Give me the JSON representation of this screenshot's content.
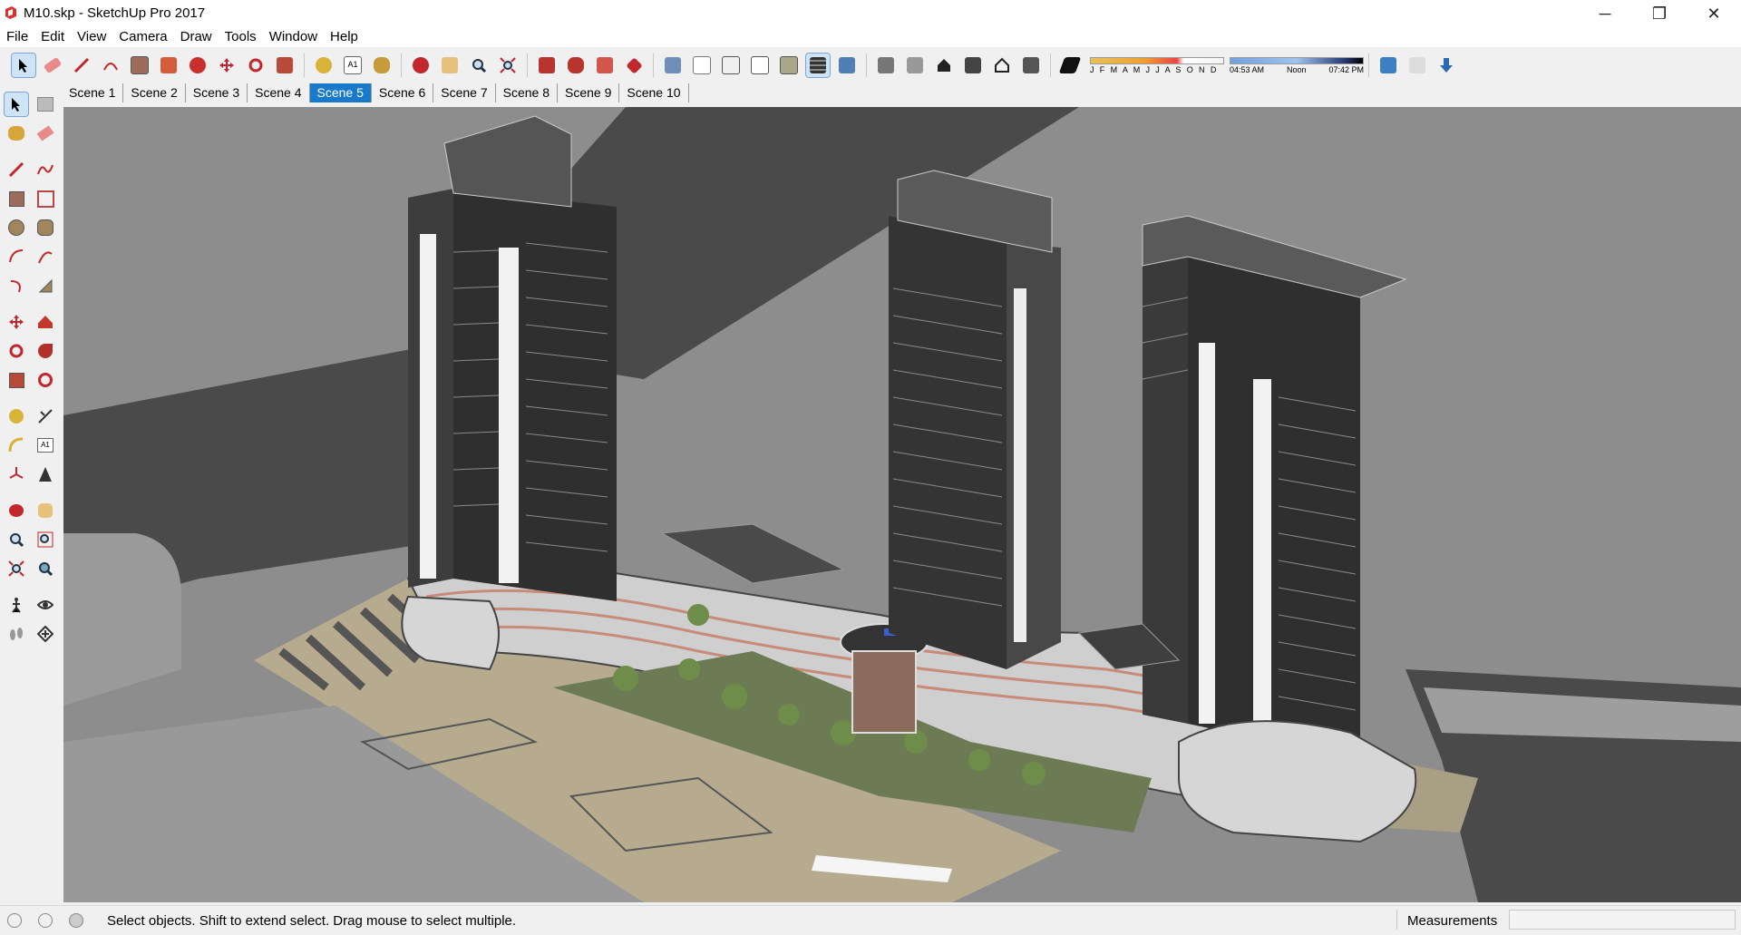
{
  "window": {
    "title": "M10.skp - SketchUp Pro 2017",
    "minimize": "─",
    "maximize": "❐",
    "close": "✕"
  },
  "menu": [
    "File",
    "Edit",
    "View",
    "Camera",
    "Draw",
    "Tools",
    "Window",
    "Help"
  ],
  "shadow_widget": {
    "months": "J F M A M J J A S O N D",
    "time_start": "04:53 AM",
    "time_mid": "Noon",
    "time_end": "07:42 PM"
  },
  "scenes": [
    "Scene 1",
    "Scene 2",
    "Scene 3",
    "Scene 4",
    "Scene 5",
    "Scene 6",
    "Scene 7",
    "Scene 8",
    "Scene 9",
    "Scene 10"
  ],
  "active_scene": "Scene 5",
  "status": {
    "message": "Select objects. Shift to extend select. Drag mouse to select multiple.",
    "measurements_label": "Measurements",
    "measurements_value": ""
  },
  "colors": {
    "selection_blue": "#1979ca",
    "ground": "#8e8e8e",
    "road": "#4a4a4a"
  }
}
